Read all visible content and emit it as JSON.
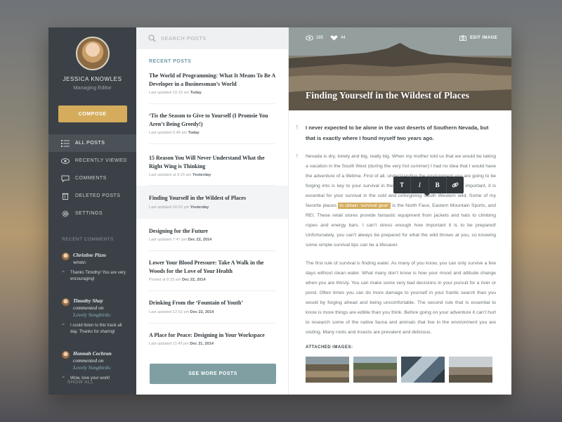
{
  "profile": {
    "name": "Jessica Knowles",
    "role": "Managing Editor"
  },
  "sidebar": {
    "compose_label": "Compose",
    "items": [
      {
        "label": "All Posts",
        "icon": "list-icon",
        "active": true
      },
      {
        "label": "Recently Viewed",
        "icon": "eye-icon",
        "active": false
      },
      {
        "label": "Comments",
        "icon": "speech-bubble-icon",
        "active": false
      },
      {
        "label": "Deleted Posts",
        "icon": "trash-icon",
        "active": false
      },
      {
        "label": "Settings",
        "icon": "gear-icon",
        "active": false
      }
    ],
    "recent_comments_title": "Recent Comments",
    "comments": [
      {
        "author": "Christine Pizzo",
        "verb": "wrote:",
        "post": "",
        "text": "Thanks Timothy! You are very encouraging!"
      },
      {
        "author": "Timothy Shay",
        "verb": "commented on",
        "post": "Lovely Songbirds:",
        "text": "I could listen to this track all day. Thanks for sharing!"
      },
      {
        "author": "Hannah Cochran",
        "verb": "commented on",
        "post": "Lovely Songbirds:",
        "text": "Wow, love your work!"
      }
    ],
    "show_all_label": "Show All"
  },
  "post_list": {
    "search_placeholder": "Search posts",
    "recent_label": "Recent Posts",
    "posts": [
      {
        "title": "The World of Programming: What It Means To Be A Developer in a Businessman’s World",
        "meta_prefix": "Last updated 10:15 am",
        "meta_day": "Today",
        "selected": false
      },
      {
        "title": "‘Tis the Season to Give to Yourself (I Promsie You Aren’t Being Greedy!)",
        "meta_prefix": "Last updated 6:48 am",
        "meta_day": "Today",
        "selected": false
      },
      {
        "title": "15 Reason You Will Never Understand What the Right Wing is Thinking",
        "meta_prefix": "Last updated at 9:15 am",
        "meta_day": "Yesterday",
        "selected": false
      },
      {
        "title": "Finding Yourself in the Wildest of Places",
        "meta_prefix": "Last updated 10:22 pm",
        "meta_day": "Yesterday",
        "selected": true
      },
      {
        "title": "Designing for the Future",
        "meta_prefix": "Last updated 7:47 pm",
        "meta_day": "Dec 22, 2014",
        "selected": false
      },
      {
        "title": "Lower Your Blood Pressure: Take A Walk in the Woods for the Love of Your Health",
        "meta_prefix": "Posted at 8:33 am",
        "meta_day": "Dec 22, 2014",
        "selected": false
      },
      {
        "title": "Drinking From the ‘Fountain of Youth’",
        "meta_prefix": "Last updated 12:52 pm",
        "meta_day": "Dec 22, 2014",
        "selected": false
      },
      {
        "title": "A Place for Peace: Designing in Your Workspace",
        "meta_prefix": "Last updated 11:49 pm",
        "meta_day": "Dec 21, 2014",
        "selected": false
      }
    ],
    "see_more_label": "See More Posts"
  },
  "article": {
    "views": "285",
    "likes": "44",
    "edit_image_label": "Edit Image",
    "title": "Finding Yourself in the Wildest of Places",
    "lead": "I never expected to be alone in the vast deserts of Southern Nevada, but that is exactly where I found myself two years ago.",
    "para1_before": "Nevada is dry, lonely and big, really big.  When my mother told us that we would be taking a vacation in the South West (during the very hot summer) I had no idea that I would have the adventure of a lifetime. First of all, understanding the environment you are going to be forging into is key to your survival in the wild, being prepared is not only important, it is essential for your survival in the cold and unforgiving South Western wild. Some of my favorite places ",
    "para1_highlight": "to obtain ‘survival gear’",
    "para1_after": " is the North Face, Eastern Mountain Sports, and REI. These retail stores provide fantastic equipment from jackets and hats to climbing ropes and energy bars. I can’t stress enough how important it is to be prepared! Unfortunately, you can’t always be prepared for what the wild throws at you, so knowing some simple survival tips can be a lifesaver.",
    "para2": "The first rule of survival is finding water. As many of you know, you can only survive a few days without clean water. What many don’t know is how your mood and attitude change when you are thirsty. You can make some very bad decisions in your pursuit for a river or pond. Often times you can do more damage to yourself in your frantic search than you would by forging ahead and being uncomfortable. The second rule that is essential to know is more things are edible than you think. Before going on your adventure it can’t hurt to research some of the native fauna and animals that live in the environment you are visiting. Many roots and insects are prevalent and delicious.",
    "toolbar": {
      "text": "T",
      "italic": "I",
      "bold": "B"
    },
    "attached_label": "Attached Images:"
  }
}
